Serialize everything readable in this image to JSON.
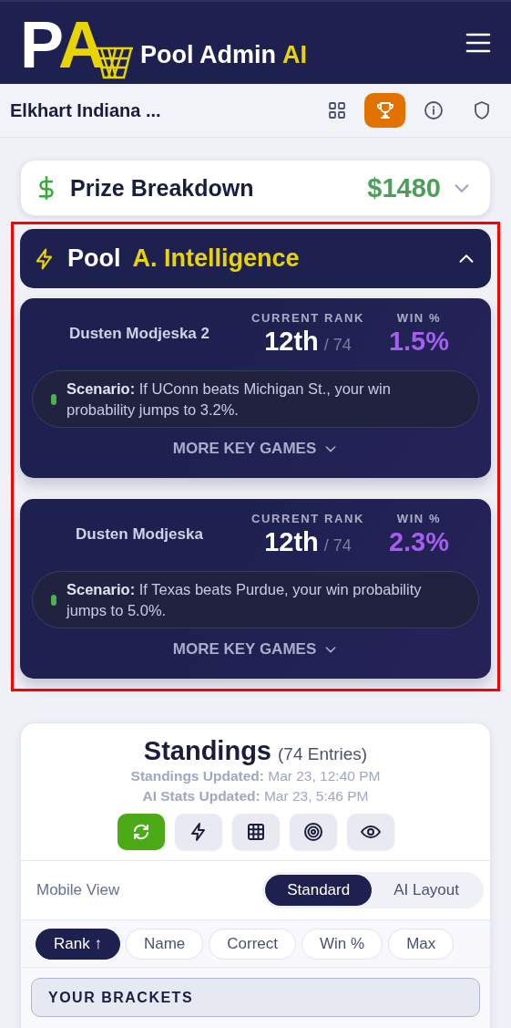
{
  "header": {
    "logo_letters": [
      "P",
      "A"
    ],
    "brand": "Pool Admin",
    "brand_accent": "AI"
  },
  "pool_bar": {
    "name": "Elkhart Indiana ...",
    "views": [
      {
        "kind": "grid",
        "selected": false
      },
      {
        "kind": "trophy",
        "selected": true
      },
      {
        "kind": "info",
        "selected": false
      },
      {
        "kind": "shield",
        "selected": false
      }
    ]
  },
  "prize": {
    "title": "Prize Breakdown",
    "amount": "$1480",
    "expanded": false
  },
  "intelligence": {
    "title": "Pool",
    "title_accent": "A. Intelligence",
    "expanded": true,
    "entries": [
      {
        "name": "Dusten Modjeska 2",
        "rank_label": "CURRENT RANK",
        "rank": "12th",
        "rank_total": "/ 74",
        "win_label": "WIN %",
        "win": "1.5%",
        "scenario": "**Scenario:** If UConn beats Michigan St., your win probability jumps to 3.2%.",
        "more": "MORE KEY GAMES"
      },
      {
        "name": "Dusten Modjeska",
        "rank_label": "CURRENT RANK",
        "rank": "12th",
        "rank_total": "/ 74",
        "win_label": "WIN %",
        "win": "2.3%",
        "scenario": "**Scenario:** If Texas beats Purdue, your win probability jumps to 5.0%.",
        "more": "MORE KEY GAMES"
      }
    ]
  },
  "standings": {
    "title": "Standings",
    "count": "(74 Entries)",
    "updates": [
      "**Standings Updated:** Mar 23, 12:40 PM",
      "**AI Stats Updated:** Mar 23, 5:46 PM"
    ],
    "tools": [
      {
        "kind": "refresh",
        "selected": true
      },
      {
        "kind": "bolt",
        "selected": false
      },
      {
        "kind": "table",
        "selected": false
      },
      {
        "kind": "target",
        "selected": false
      },
      {
        "kind": "eye",
        "selected": false
      }
    ],
    "mobile_view": {
      "label": "Mobile View",
      "options": [
        {
          "label": "Standard",
          "selected": true
        },
        {
          "label": "AI Layout",
          "selected": false
        }
      ]
    },
    "sort": [
      {
        "label": "Rank ↑",
        "selected": true
      },
      {
        "label": "Name",
        "selected": false
      },
      {
        "label": "Correct",
        "selected": false
      },
      {
        "label": "Win %",
        "selected": false
      },
      {
        "label": "Max",
        "selected": false
      }
    ],
    "group": "YOUR BRACKETS"
  }
}
